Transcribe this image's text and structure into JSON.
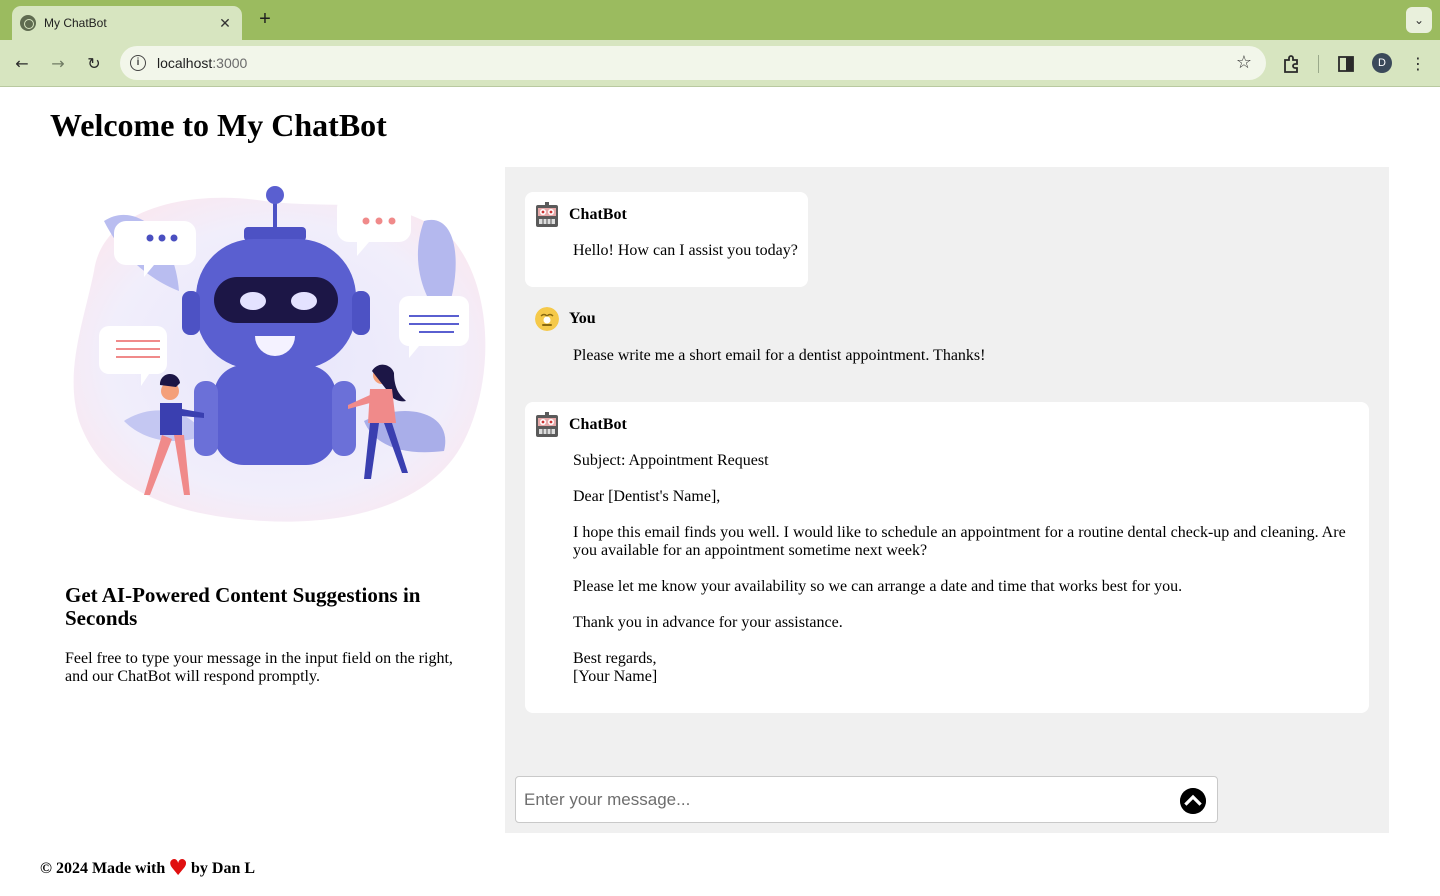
{
  "browser": {
    "tab_title": "My ChatBot",
    "tab_close": "✕",
    "new_tab": "+",
    "tab_menu": "⌄",
    "url_host": "localhost",
    "url_port": ":3000",
    "profile_initial": "D"
  },
  "page": {
    "title": "Welcome to My ChatBot"
  },
  "left": {
    "heading": "Get AI-Powered Content Suggestions in Seconds",
    "text": "Feel free to type your message in the input field on the right, and our ChatBot will respond promptly."
  },
  "chat": {
    "messages": [
      {
        "sender": "ChatBot",
        "role": "bot",
        "paragraphs": [
          "Hello! How can I assist you today?"
        ]
      },
      {
        "sender": "You",
        "role": "user",
        "paragraphs": [
          "Please write me a short email for a dentist appointment. Thanks!"
        ]
      },
      {
        "sender": "ChatBot",
        "role": "bot",
        "paragraphs": [
          "Subject: Appointment Request",
          "Dear [Dentist's Name],",
          "I hope this email finds you well. I would like to schedule an appointment for a routine dental check-up and cleaning. Are you available for an appointment sometime next week?",
          "Please let me know your availability so we can arrange a date and time that works best for you.",
          "Thank you in advance for your assistance.",
          "Best regards,\n[Your Name]"
        ]
      }
    ],
    "input_placeholder": "Enter your message..."
  },
  "footer": {
    "prefix": "© 2024 Made with",
    "heart": "♥",
    "suffix": "by Dan L"
  },
  "colors": {
    "tabbar": "#9bbb5f",
    "toolbar": "#d7e5c0",
    "chat_panel": "#f0f0f0",
    "robot": "#5a5fd0",
    "heart": "#e01010"
  }
}
